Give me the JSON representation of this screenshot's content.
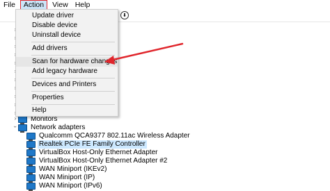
{
  "menubar": {
    "items": [
      {
        "label": "File"
      },
      {
        "label": "Action"
      },
      {
        "label": "View"
      },
      {
        "label": "Help"
      }
    ]
  },
  "action_menu": {
    "items": [
      {
        "label": "Update driver"
      },
      {
        "label": "Disable device"
      },
      {
        "label": "Uninstall device"
      },
      {
        "label": "Add drivers"
      },
      {
        "label": "Scan for hardware changes"
      },
      {
        "label": "Add legacy hardware"
      },
      {
        "label": "Devices and Printers"
      },
      {
        "label": "Properties"
      },
      {
        "label": "Help"
      }
    ]
  },
  "tree": {
    "monitors": "Monitors",
    "network_adapters": "Network adapters",
    "adapters": [
      "Qualcomm QCA9377 802.11ac Wireless Adapter",
      "Realtek PCIe FE Family Controller",
      "VirtualBox Host-Only Ethernet Adapter",
      "VirtualBox Host-Only Ethernet Adapter #2",
      "WAN Miniport (IKEv2)",
      "WAN Miniport (IP)",
      "WAN Miniport (IPv6)"
    ]
  },
  "colors": {
    "highlight_border": "#e0262c",
    "arrow": "#e0262c",
    "selection": "#cce8ff",
    "menu_bg": "#f2f2f2"
  }
}
